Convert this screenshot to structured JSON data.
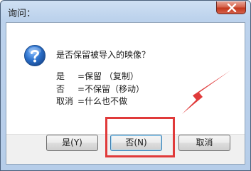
{
  "dialog": {
    "title": "询问：",
    "question": "是否保留被导入的映像？",
    "options": [
      {
        "key": "是",
        "desc": "=保留  （复制）"
      },
      {
        "key": "否",
        "desc": "=不保留（移动）"
      },
      {
        "key": "取消",
        "desc": "=什么也不做"
      }
    ],
    "buttons": {
      "yes_label": "是(Y)",
      "no_label": "否(N)",
      "cancel_label": "取消"
    }
  },
  "icons": {
    "dialog_icon": "question-icon",
    "close": "close-icon",
    "annotation": "red-arrow-icon"
  },
  "colors": {
    "annotation": "#e03a3a",
    "icon_blue": "#2a6fc9",
    "close_red": "#c3381e"
  }
}
